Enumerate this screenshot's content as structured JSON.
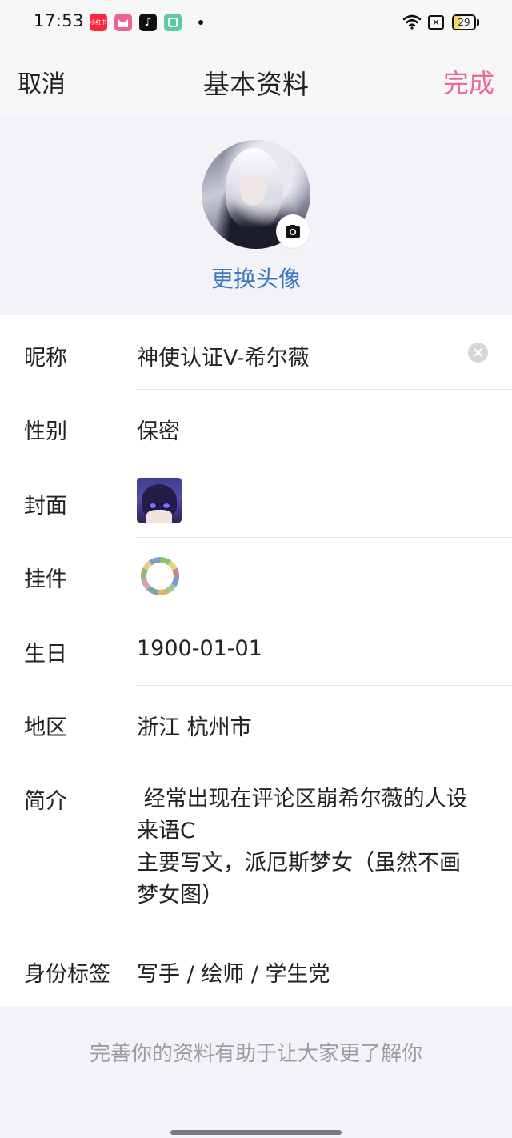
{
  "status_bar": {
    "time": "17:53",
    "apps": [
      {
        "name": "xiaohongshu-app-icon",
        "label": "小红书",
        "color": "#ff2442"
      },
      {
        "name": "pink-cat-app-icon",
        "label": "",
        "color": "#f06292"
      },
      {
        "name": "tiktok-app-icon",
        "label": "♪",
        "color": "#111111"
      },
      {
        "name": "book-app-icon",
        "label": "",
        "color": "#5cc9a7"
      }
    ],
    "battery": "29"
  },
  "nav": {
    "cancel": "取消",
    "title": "基本资料",
    "done": "完成",
    "done_color": "#ec6a92"
  },
  "avatar": {
    "change_label": "更换头像",
    "link_color": "#3a78c4"
  },
  "form": {
    "nickname": {
      "label": "昵称",
      "value": "神使认证V-希尔薇"
    },
    "gender": {
      "label": "性别",
      "value": "保密"
    },
    "cover": {
      "label": "封面"
    },
    "pendant": {
      "label": "挂件"
    },
    "birthday": {
      "label": "生日",
      "value": "1900-01-01"
    },
    "region": {
      "label": "地区",
      "value": "浙江 杭州市"
    },
    "bio": {
      "label": "简介",
      "lines": [
        " 经常出现在评论区崩希尔薇的人设",
        "来语C",
        "主要写文，派厄斯梦女（虽然不画",
        "梦女图）"
      ]
    },
    "identity": {
      "label": "身份标签",
      "value": "写手 / 绘师 / 学生党"
    }
  },
  "footer": {
    "tip": "完善你的资料有助于让大家更了解你"
  }
}
